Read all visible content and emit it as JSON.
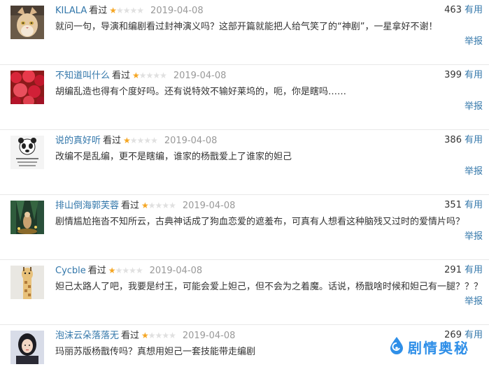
{
  "ui": {
    "seen_label": "看过",
    "useful_label": "有用",
    "report_label": "举报"
  },
  "colors": {
    "link": "#3377aa",
    "star_on": "#f5a623",
    "star_off": "#e0e0e0",
    "date": "#999999",
    "watermark": "#2f8fe8"
  },
  "comments": [
    {
      "username": "KILALA",
      "rating": 1,
      "date": "2019-04-08",
      "votes": "463",
      "content": "就问一句，导演和编剧看过封神演义吗？这部开篇就能把人给气笑了的“神剧”，一星拿好不谢！",
      "avatar_icon": "cat-avatar"
    },
    {
      "username": "不知道叫什么",
      "rating": 1,
      "date": "2019-04-08",
      "votes": "399",
      "content": "胡编乱造也得有个度好吗。还有说特效不输好莱坞的，呃，你是瞎吗……",
      "avatar_icon": "red-flowers-avatar"
    },
    {
      "username": "说的真好听",
      "rating": 1,
      "date": "2019-04-08",
      "votes": "386",
      "content": "改编不是乱编，更不是瞎编，谁家的杨戬爱上了谁家的妲己",
      "avatar_icon": "panda-meme-avatar"
    },
    {
      "username": "排山倒海郭芙蓉",
      "rating": 1,
      "date": "2019-04-08",
      "votes": "351",
      "content": "剧情尴尬拖沓不知所云，古典神话成了狗血恋爱的遮羞布，可真有人想看这种脑残又过时的爱情片吗？",
      "avatar_icon": "forest-avatar"
    },
    {
      "username": "Cycble",
      "rating": 1,
      "date": "2019-04-08",
      "votes": "291",
      "content": "妲己太路人了吧，我要是纣王，可能会爱上妲己，但不会为之着魔。话说，杨戬啥时候和妲己有一腿？？？",
      "avatar_icon": "giraffe-avatar"
    },
    {
      "username": "泡沫云朵落落无",
      "rating": 1,
      "date": "2019-04-08",
      "votes": "269",
      "content": "玛丽苏版杨戬传吗？真想用妲己一套技能带走编剧",
      "avatar_icon": "woman-portrait-avatar"
    }
  ],
  "watermark": {
    "text": "剧情奥秘",
    "icon": "droplet-logo-icon"
  }
}
